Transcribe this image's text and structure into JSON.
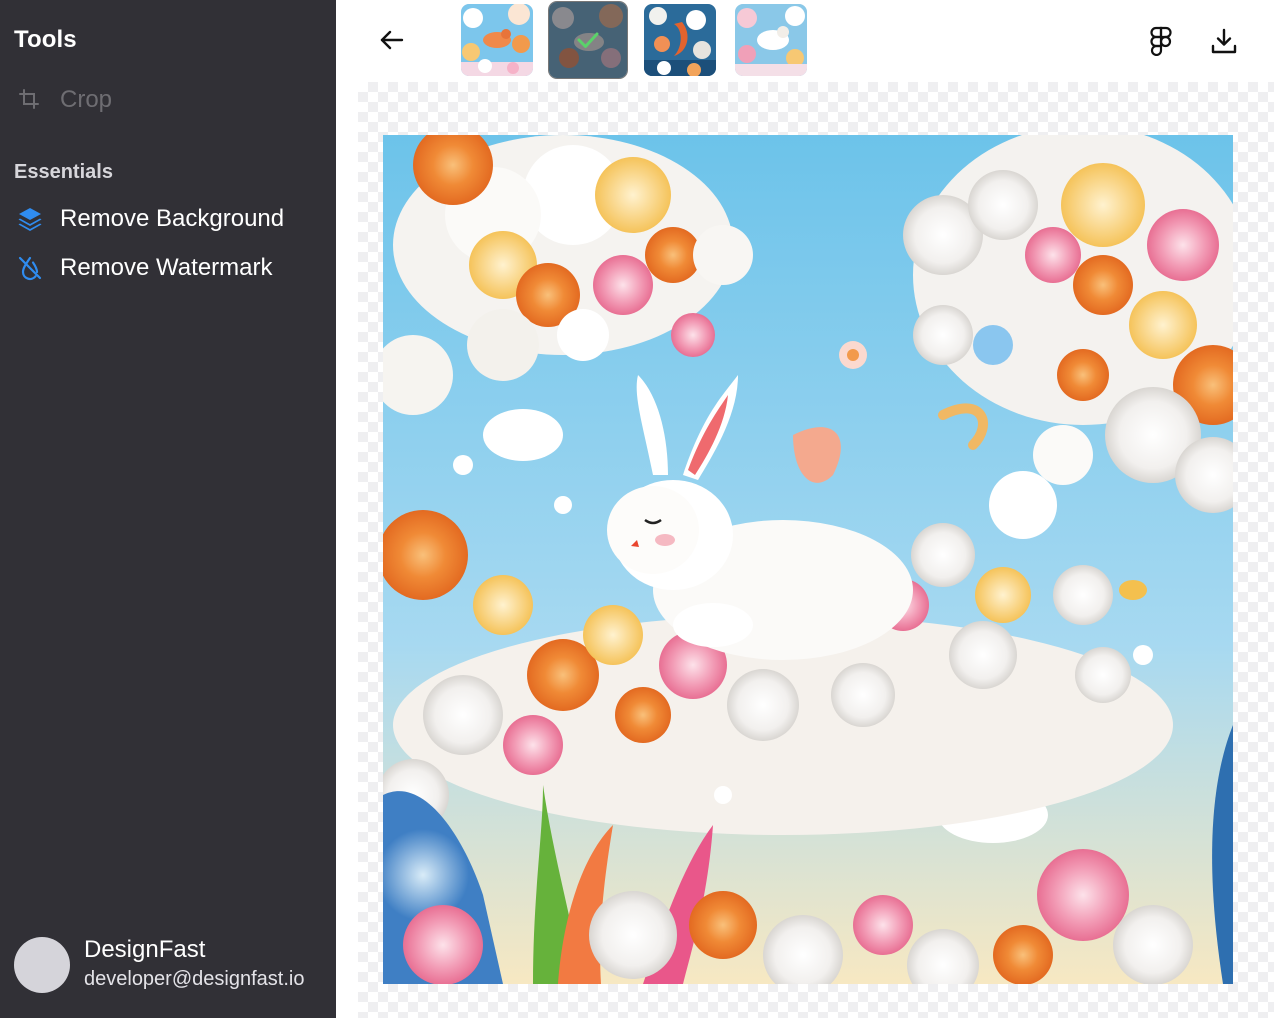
{
  "sidebar": {
    "title": "Tools",
    "tools": [
      {
        "label": "Crop",
        "icon": "crop-icon",
        "enabled": false
      }
    ],
    "section_title": "Essentials",
    "essentials": [
      {
        "label": "Remove Background",
        "icon": "layers-icon"
      },
      {
        "label": "Remove Watermark",
        "icon": "watermark-off-icon"
      }
    ],
    "user": {
      "name": "DesignFast",
      "email": "developer@designfast.io"
    }
  },
  "toolbar": {
    "back_icon": "arrow-left-icon",
    "figma_icon": "figma-icon",
    "download_icon": "download-icon",
    "thumbnails": [
      {
        "name": "thumbnail-1",
        "selected": false
      },
      {
        "name": "thumbnail-2",
        "selected": true
      },
      {
        "name": "thumbnail-3",
        "selected": false
      },
      {
        "name": "thumbnail-4",
        "selected": false
      }
    ]
  },
  "colors": {
    "sidebar_bg": "#313036",
    "accent_blue": "#2f8cf0",
    "check_green": "#5ad26a"
  }
}
